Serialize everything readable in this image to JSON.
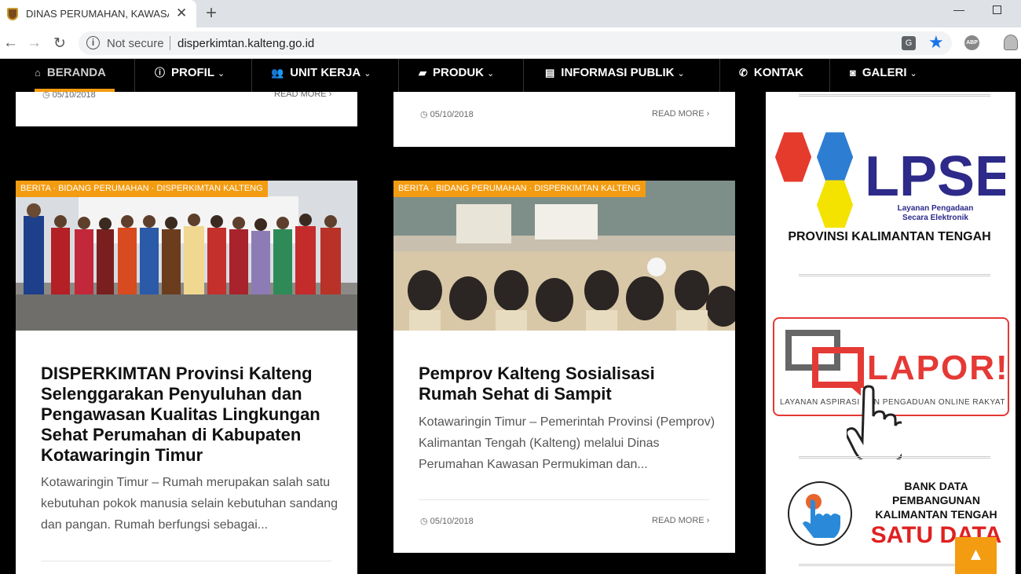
{
  "browser": {
    "tab_title": "DINAS PERUMAHAN, KAWASAN",
    "tab_close": "✕",
    "new_tab": "+",
    "not_secure": "Not secure",
    "url": "disperkimtan.kalteng.go.id",
    "abp": "ABP"
  },
  "nav": {
    "items": [
      {
        "label": "BERANDA",
        "icon": "home-icon"
      },
      {
        "label": "PROFIL",
        "icon": "info-icon"
      },
      {
        "label": "UNIT KERJA",
        "icon": "users-icon"
      },
      {
        "label": "PRODUK",
        "icon": "folder-icon"
      },
      {
        "label": "INFORMASI PUBLIK",
        "icon": "newspaper-icon"
      },
      {
        "label": "KONTAK",
        "icon": "phone-icon"
      },
      {
        "label": "GALERI",
        "icon": "camera-icon"
      }
    ],
    "active_color": "#f39c12"
  },
  "posts": {
    "top_left": {
      "date": "05/10/2018",
      "read_more": "READ MORE"
    },
    "top_right": {
      "date": "05/10/2018",
      "read_more": "READ MORE"
    },
    "left": {
      "category": "BERITA · BIDANG PERUMAHAN · DISPERKIMTAN KALTENG",
      "title": "DISPERKIMTAN Provinsi Kalteng Selenggarakan Penyuluhan dan Pengawasan Kualitas Lingkungan Sehat Perumahan di Kabupaten Kotawaringin Timur",
      "excerpt": "Kotawaringin Timur – Rumah merupakan salah satu kebutuhan pokok manusia selain kebutuhan sandang dan pangan. Rumah berfungsi sebagai..."
    },
    "right": {
      "category": "BERITA · BIDANG PERUMAHAN · DISPERKIMTAN KALTENG",
      "title": "Pemprov Kalteng Sosialisasi Rumah Sehat di Sampit",
      "excerpt": "Kotawaringin Timur – Pemerintah Provinsi (Pemprov) Kalimantan Tengah (Kalteng) melalui Dinas Perumahan Kawasan Permukiman dan...",
      "date": "05/10/2018",
      "read_more": "READ MORE"
    }
  },
  "sidebar": {
    "lpse": {
      "logo_text": "LPSE",
      "sub1": "Layanan Pengadaan",
      "sub2": "Secara Elektronik",
      "province": "PROVINSI KALIMANTAN TENGAH"
    },
    "lapor": {
      "logo_text": "LAPOR!",
      "sub": "LAYANAN ASPIRASI DAN PENGADUAN ONLINE RAKYAT"
    },
    "satudata": {
      "line1": "BANK DATA",
      "line2": "PEMBANGUNAN",
      "line3": "KALIMANTAN TENGAH",
      "brand": "SATU DATA"
    }
  },
  "back_to_top": "▲"
}
